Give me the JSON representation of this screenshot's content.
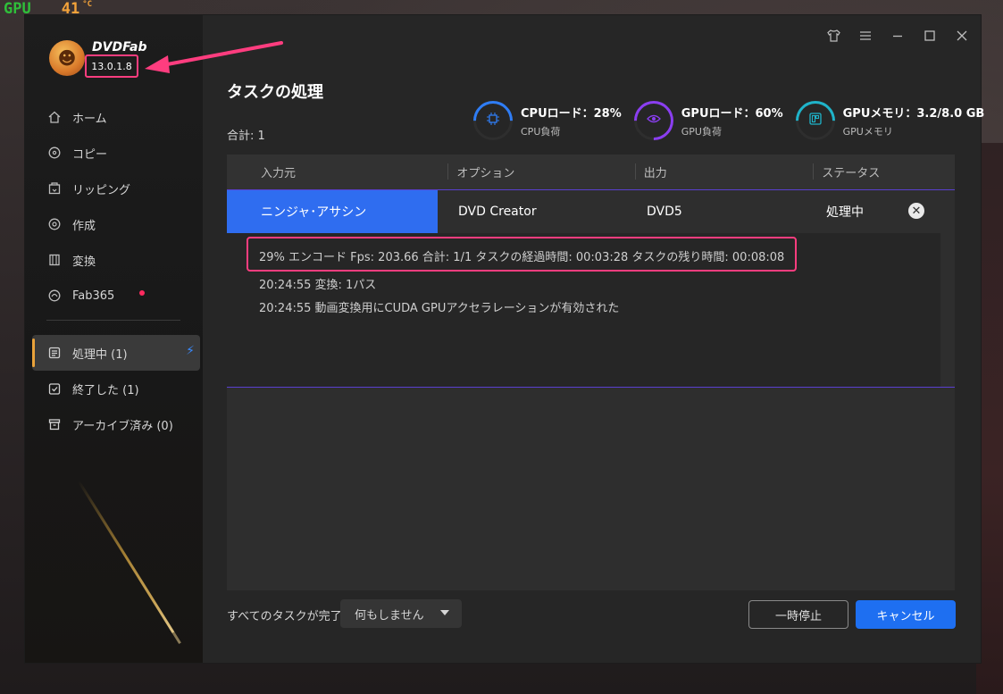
{
  "overlay": {
    "gpu_label": "GPU",
    "temp_value": "41",
    "temp_unit": "°C"
  },
  "app": {
    "logo_text": "DVDFab",
    "version": "13.0.1.8"
  },
  "sidebar": {
    "items": [
      {
        "label": "ホーム",
        "icon": "home-icon"
      },
      {
        "label": "コピー",
        "icon": "copy-icon"
      },
      {
        "label": "リッピング",
        "icon": "ripping-icon"
      },
      {
        "label": "作成",
        "icon": "creator-icon"
      },
      {
        "label": "変換",
        "icon": "convert-icon"
      },
      {
        "label": "Fab365",
        "icon": "fab365-icon"
      }
    ],
    "queue": [
      {
        "label": "処理中 (1)",
        "icon": "processing-icon"
      },
      {
        "label": "終了した (1)",
        "icon": "finished-icon"
      },
      {
        "label": "アーカイブ済み (0)",
        "icon": "archive-icon"
      }
    ]
  },
  "header": {
    "title": "タスクの処理",
    "total": "合計: 1"
  },
  "stats": [
    {
      "title": "CPUロード：28%",
      "sub": "CPU負荷",
      "percent": 28,
      "color": "#2f7df5",
      "icon": "cpu-icon"
    },
    {
      "title": "GPUロード：60%",
      "sub": "GPU負荷",
      "percent": 60,
      "color": "#8a3ef0",
      "icon": "gpu-icon"
    },
    {
      "title": "GPUメモリ：3.2/8.0 GB",
      "sub": "GPUメモリ",
      "percent": 40,
      "color": "#1fb3c9",
      "icon": "memory-icon"
    }
  ],
  "table": {
    "headers": [
      "入力元",
      "オプション",
      "出力",
      "ステータス"
    ],
    "row": {
      "source": "ニンジャ･アサシン",
      "option": "DVD Creator",
      "output": "DVD5",
      "status": "処理中",
      "progress": 29
    },
    "log": [
      "29%  エンコード Fps: 203.66   合計: 1/1  タスクの経過時間: 00:03:28  タスクの残り時間: 00:08:08",
      "20:24:55  変換: 1パス",
      "20:24:55  動画変換用にCUDA GPUアクセラレーションが有効された"
    ]
  },
  "footer": {
    "when_done_label": "すべてのタスクが完了：",
    "when_done_value": "何もしません",
    "pause_label": "一時停止",
    "cancel_label": "キャンセル"
  }
}
